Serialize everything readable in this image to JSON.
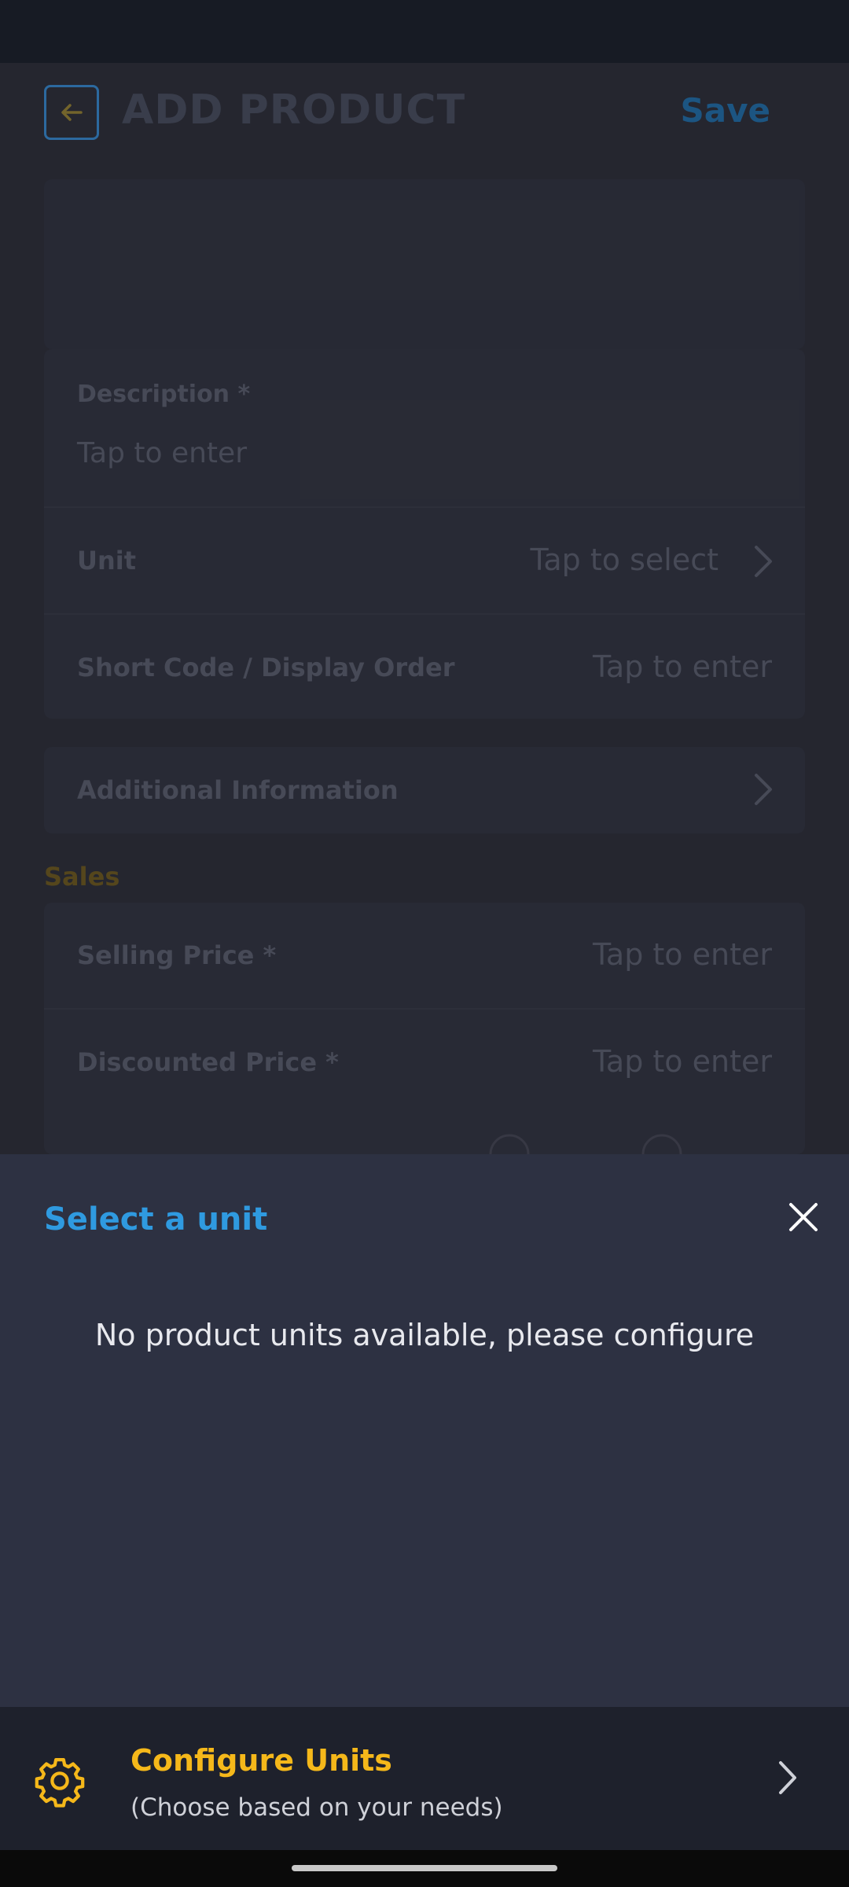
{
  "app_bar": {
    "title": "ADD PRODUCT",
    "save_label": "Save"
  },
  "form": {
    "description_label": "Description *",
    "description_placeholder": "Tap to enter",
    "unit_label": "Unit",
    "unit_value": "Tap to select",
    "short_code_label": "Short Code / Display Order",
    "short_code_value": "Tap to enter",
    "additional_info_label": "Additional Information"
  },
  "sales": {
    "header": "Sales",
    "selling_price_label": "Selling Price *",
    "selling_price_value": "Tap to enter",
    "discounted_price_label": "Discounted Price *",
    "discounted_price_value": "Tap to enter"
  },
  "sheet": {
    "title": "Select a unit",
    "empty_message": "No product units available, please configure"
  },
  "configure": {
    "title": "Configure Units",
    "subtitle": "(Choose based on your needs)"
  },
  "colors": {
    "accent_blue": "#2f9ae0",
    "accent_yellow": "#f5b81a",
    "sheet_bg": "#2d3142"
  },
  "icons": {
    "back": "arrow-left-icon",
    "chevron": "chevron-right-icon",
    "close": "close-icon",
    "settings": "gear-icon"
  }
}
